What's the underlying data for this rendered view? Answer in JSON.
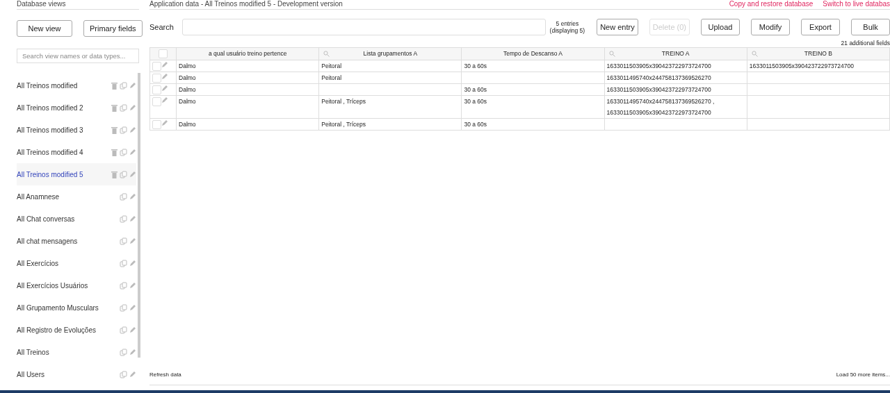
{
  "sidebar": {
    "title": "Database views",
    "buttons": [
      {
        "label": "New view"
      },
      {
        "label": "Primary fields"
      }
    ],
    "search": {
      "placeholder": "Search view names or data types..."
    },
    "items": [
      {
        "label": "All Treinos modified",
        "selected": false,
        "deletable": true
      },
      {
        "label": "All Treinos modified 2",
        "selected": false,
        "deletable": true
      },
      {
        "label": "All Treinos modified 3",
        "selected": false,
        "deletable": true
      },
      {
        "label": "All Treinos modified 4",
        "selected": false,
        "deletable": true
      },
      {
        "label": "All Treinos modified 5",
        "selected": true,
        "deletable": true
      },
      {
        "label": "All Anamnese",
        "selected": false,
        "deletable": false
      },
      {
        "label": "All Chat conversas",
        "selected": false,
        "deletable": false
      },
      {
        "label": "All chat mensagens",
        "selected": false,
        "deletable": false
      },
      {
        "label": "All Exercícios",
        "selected": false,
        "deletable": false
      },
      {
        "label": "All Exercícios Usuários",
        "selected": false,
        "deletable": false
      },
      {
        "label": "All Grupamento Musculars",
        "selected": false,
        "deletable": false
      },
      {
        "label": "All Registro de Evoluções",
        "selected": false,
        "deletable": false
      },
      {
        "label": "All Treinos",
        "selected": false,
        "deletable": false
      },
      {
        "label": "All Users",
        "selected": false,
        "deletable": false
      }
    ]
  },
  "main": {
    "title": "Application data - All Treinos modified 5 - Development version",
    "links": [
      "Copy and restore database",
      "Switch to live databas"
    ],
    "search_label": "Search",
    "select_all": {
      "checked": false
    },
    "entries": "5 entries",
    "displaying": "(displaying 5)",
    "buttons": [
      {
        "label": "New entry",
        "disabled": false
      },
      {
        "label": "Delete (0)",
        "disabled": true
      },
      {
        "label": "Upload",
        "disabled": false
      },
      {
        "label": "Modify",
        "disabled": false
      },
      {
        "label": "Export",
        "disabled": false
      },
      {
        "label": "Bulk",
        "disabled": false
      }
    ],
    "additional_fields": "21 additional fields",
    "table": {
      "columns": [
        {
          "label": "a qual usuário treino pertence",
          "filterable": false
        },
        {
          "label": "Lista grupamentos A",
          "filterable": true
        },
        {
          "label": "Tempo de Descanso A",
          "filterable": false
        },
        {
          "label": "TREINO A",
          "filterable": true
        },
        {
          "label": "TREINO B",
          "filterable": true
        }
      ],
      "rows": [
        {
          "checked": false,
          "cells": [
            "Dalmo",
            "Peitoral",
            "30 a 60s",
            "1633011503905x390423722973724700",
            "1633011503905x390423722973724700"
          ]
        },
        {
          "checked": false,
          "cells": [
            "Dalmo",
            "Peitoral",
            "",
            "1633011495740x244758137369526270",
            ""
          ]
        },
        {
          "checked": false,
          "cells": [
            "Dalmo",
            "",
            "30 a 60s",
            "1633011503905x390423722973724700",
            ""
          ]
        },
        {
          "checked": false,
          "cells": [
            "Dalmo",
            "Peitoral , Tríceps",
            "30 a 60s",
            "1633011495740x244758137369526270 , 1633011503905x390423722973724700",
            ""
          ]
        },
        {
          "checked": false,
          "cells": [
            "Dalmo",
            "Peitoral , Tríceps",
            "30 a 60s",
            "",
            ""
          ]
        }
      ]
    },
    "refresh": "Refresh data",
    "load_more": "Load 50 more items..."
  }
}
